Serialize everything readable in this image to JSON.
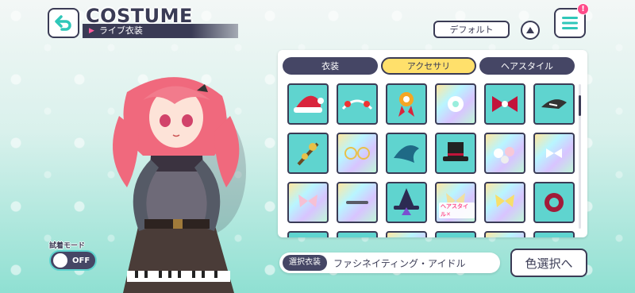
{
  "header": {
    "title": "COSTUME",
    "subtitle": "ライブ衣装",
    "default_label": "デフォルト",
    "notification_count": "!"
  },
  "tabs": [
    {
      "label": "衣装",
      "active": false
    },
    {
      "label": "アクセサリ",
      "active": true
    },
    {
      "label": "ヘアスタイル",
      "active": false
    }
  ],
  "items": [
    {
      "icon": "santa-hat-icon",
      "style": "plain",
      "tag": ""
    },
    {
      "icon": "headband-icon",
      "style": "plain",
      "tag": ""
    },
    {
      "icon": "rosette-icon",
      "style": "plain",
      "tag": ""
    },
    {
      "icon": "flower-clip-icon",
      "style": "rainbow",
      "tag": ""
    },
    {
      "icon": "ribbon-bow-icon",
      "style": "plain",
      "tag": ""
    },
    {
      "icon": "bird-clip-icon",
      "style": "plain",
      "tag": ""
    },
    {
      "icon": "branch-clip-icon",
      "style": "plain",
      "tag": ""
    },
    {
      "icon": "glasses-icon",
      "style": "rainbow",
      "tag": ""
    },
    {
      "icon": "fin-accessory-icon",
      "style": "plain",
      "tag": ""
    },
    {
      "icon": "top-hat-icon",
      "style": "plain",
      "tag": ""
    },
    {
      "icon": "flower-crown-icon",
      "style": "rainbow",
      "tag": ""
    },
    {
      "icon": "small-bow-icon",
      "style": "rainbow",
      "tag": ""
    },
    {
      "icon": "pink-bow-icon",
      "style": "rainbow",
      "tag": ""
    },
    {
      "icon": "hair-pin-icon",
      "style": "rainbow",
      "tag": ""
    },
    {
      "icon": "witch-hat-icon",
      "style": "plain",
      "tag": ""
    },
    {
      "icon": "butterfly-icon",
      "style": "rainbow",
      "tag": "ヘアスタイル✕"
    },
    {
      "icon": "yellow-ribbon-icon",
      "style": "rainbow",
      "tag": ""
    },
    {
      "icon": "red-scrunchie-icon",
      "style": "plain",
      "tag": ""
    },
    {
      "icon": "partial-item-icon",
      "style": "plain",
      "tag": ""
    },
    {
      "icon": "partial-item-icon",
      "style": "plain",
      "tag": ""
    },
    {
      "icon": "partial-item-icon",
      "style": "rainbow",
      "tag": ""
    },
    {
      "icon": "partial-item-icon",
      "style": "plain",
      "tag": ""
    },
    {
      "icon": "partial-item-icon",
      "style": "rainbow",
      "tag": ""
    },
    {
      "icon": "partial-item-icon",
      "style": "plain",
      "tag": ""
    }
  ],
  "selected": {
    "label": "選択衣装",
    "name": "ファシネイティング・アイドル"
  },
  "color_select_label": "色選択へ",
  "trial_mode": {
    "label": "試着モード",
    "state": "OFF"
  },
  "colors": {
    "navy": "#3a3b55",
    "accent_yellow": "#ffe06b",
    "teal": "#5fd4cf",
    "pink": "#ff4c8a"
  }
}
